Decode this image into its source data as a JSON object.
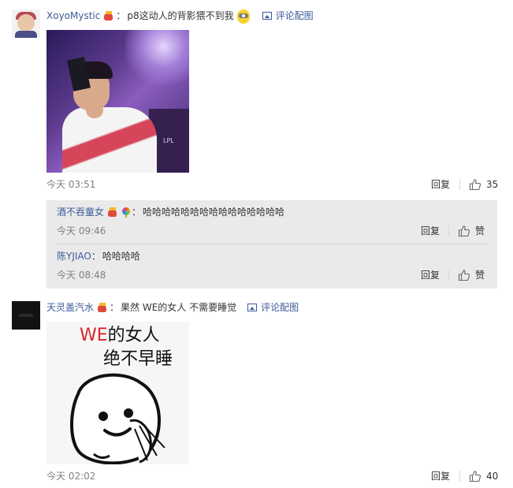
{
  "comments": [
    {
      "username": "XoyoMystic",
      "badge_icon": "vip-heart-badge-icon",
      "colon": "：",
      "text": "p8这动人的背影猥不到我",
      "emoji_icon": "minion-icon",
      "pic_link": "评论配图",
      "image_icon": "picture-icon",
      "time": "今天 03:51",
      "reply_label": "回复",
      "like_count": "35",
      "replies": [
        {
          "username": "酒不吞童女",
          "colon": "：",
          "text": "哈哈哈哈哈哈哈哈哈哈哈哈哈哈哈",
          "time": "今天 09:46",
          "reply_label": "回复",
          "like_label": "赞"
        },
        {
          "username": "陈YJIAO",
          "colon": "：",
          "text": "哈哈哈哈",
          "time": "今天 08:48",
          "reply_label": "回复",
          "like_label": "赞"
        }
      ]
    },
    {
      "username": "天灵盖汽水",
      "badge_icon": "vip-heart-badge-icon",
      "colon": "：",
      "text": "果然 WE的女人 不需要睡觉",
      "pic_link": "评论配图",
      "image_icon": "picture-icon",
      "meme_caption_we": "WE",
      "meme_caption_rest": "的女人",
      "meme_caption_line2": "绝不早睡",
      "time": "今天 02:02",
      "reply_label": "回复",
      "like_count": "40"
    }
  ],
  "colors": {
    "link": "#3b5a9a",
    "meta": "#808080",
    "reply_bg": "#eaeaea",
    "meme_we": "#d9252b"
  }
}
